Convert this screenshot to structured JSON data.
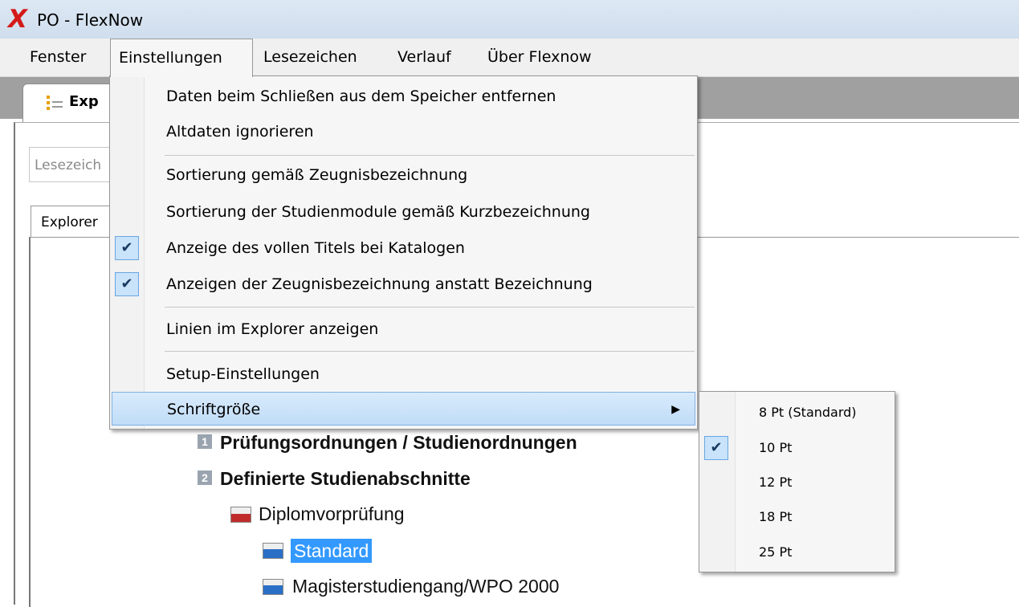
{
  "window": {
    "title": "PO - FlexNow",
    "app_icon": "flexnow-x-logo"
  },
  "menubar": {
    "items": [
      "Fenster",
      "Einstellungen",
      "Lesezeichen",
      "Verlauf",
      "Über Flexnow"
    ]
  },
  "doc_tab": {
    "label": "Exp"
  },
  "bookmark_field": {
    "placeholder": "Lesezeich"
  },
  "explorer_tab": {
    "label": "Explorer"
  },
  "tree": {
    "items": [
      {
        "badge": "1",
        "label": "Prüfungsordnungen / Studienordnungen"
      },
      {
        "badge": "2",
        "label": "Definierte Studienabschnitte"
      },
      {
        "label": "Diplomvorprüfung"
      },
      {
        "label": "Standard",
        "selected": true
      },
      {
        "label": "Magisterstudiengang/WPO 2000"
      }
    ]
  },
  "einstellungen_menu": {
    "items": [
      {
        "label": "Daten beim Schließen aus dem Speicher entfernen",
        "checked": false
      },
      {
        "label": "Altdaten ignorieren",
        "checked": false
      },
      {
        "label": "Sortierung gemäß Zeugnisbezeichnung",
        "checked": false
      },
      {
        "label": "Sortierung der Studienmodule gemäß Kurzbezeichnung",
        "checked": false
      },
      {
        "label": "Anzeige des vollen Titels bei Katalogen",
        "checked": true
      },
      {
        "label": "Anzeigen der Zeugnisbezeichnung anstatt Bezeichnung",
        "checked": true
      },
      {
        "label": "Linien im Explorer anzeigen",
        "checked": false
      },
      {
        "label": "Setup-Einstellungen",
        "checked": false
      },
      {
        "label": "Schriftgröße",
        "checked": false,
        "submenu": true,
        "highlighted": true
      }
    ],
    "check_glyph": "✔",
    "submenu_arrow": "▶"
  },
  "schriftgroesse_submenu": {
    "items": [
      {
        "label": "8 Pt (Standard)",
        "checked": false
      },
      {
        "label": "10 Pt",
        "checked": true
      },
      {
        "label": "12 Pt",
        "checked": false
      },
      {
        "label": "18 Pt",
        "checked": false
      },
      {
        "label": "25 Pt",
        "checked": false
      }
    ]
  },
  "colors": {
    "menu_highlight": "#c0dcf7",
    "selection": "#3399ff",
    "app_icon": "#d41a1a"
  }
}
